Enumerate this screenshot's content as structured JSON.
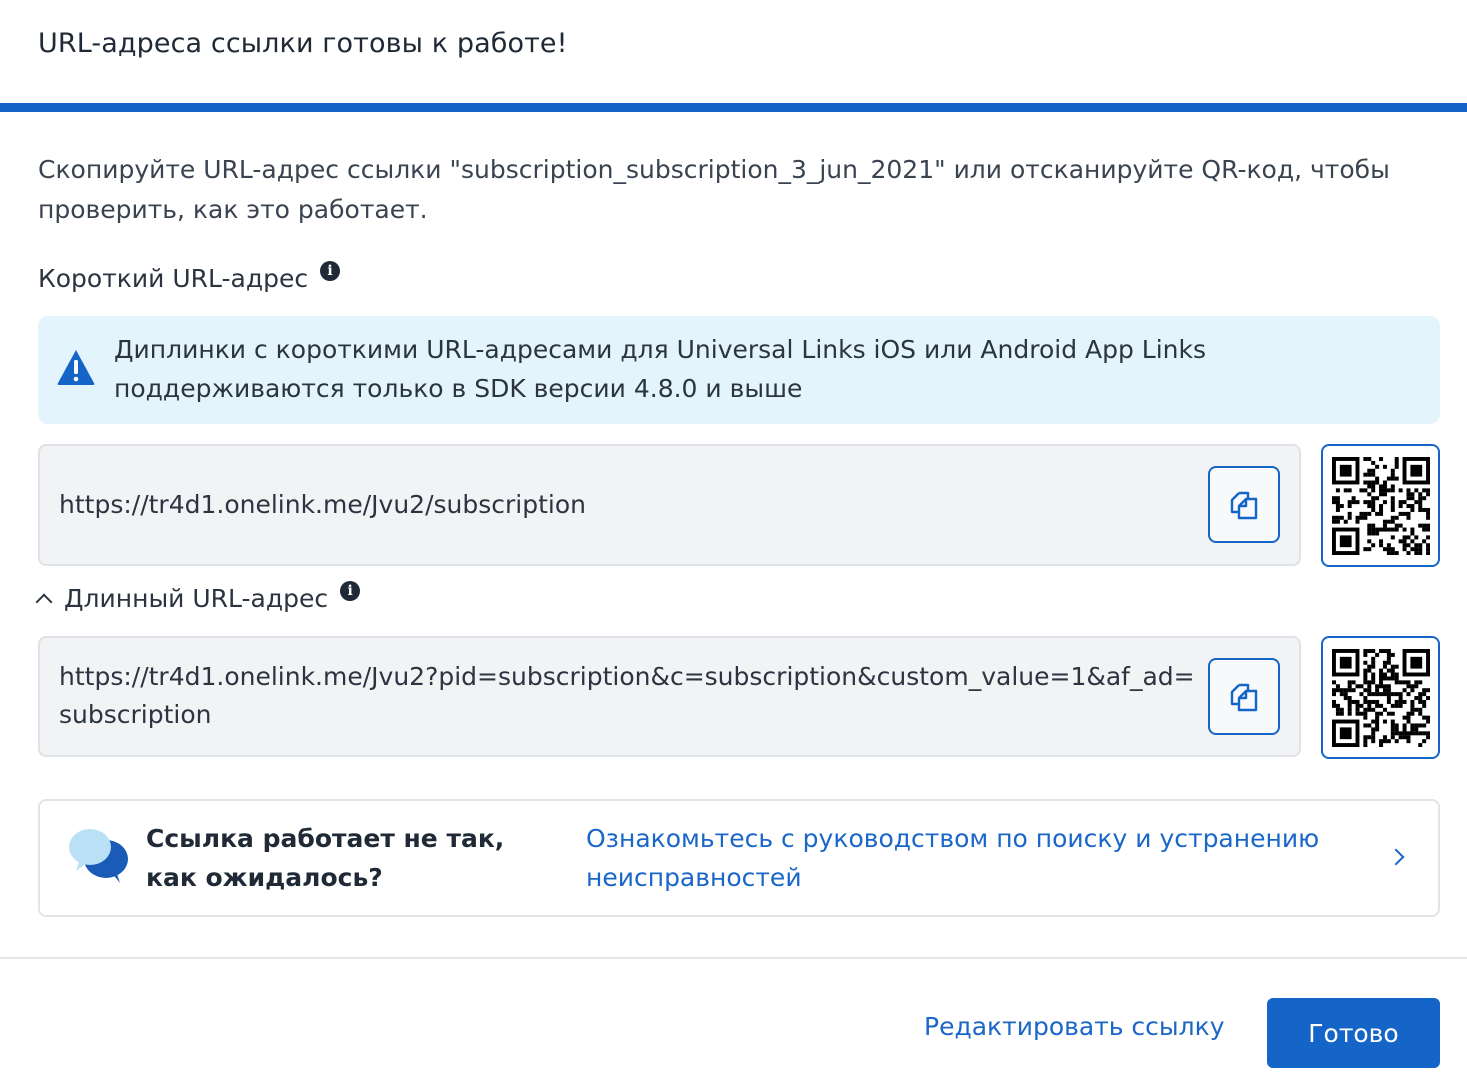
{
  "header": {
    "title": "URL-адреса ссылки готовы к работе!"
  },
  "description": "Скопируйте URL-адрес ссылки \"subscription_subscription_3_jun_2021\" или отсканируйте QR-код, чтобы проверить, как это работает.",
  "short_url": {
    "label": "Короткий URL-адрес",
    "info_icon": "i",
    "alert_text": "Диплинки с короткими URL-адресами для Universal Links iOS или Android App Links поддерживаются только в SDK версии 4.8.0 и выше",
    "value": "https://tr4d1.onelink.me/Jvu2/subscription"
  },
  "long_url": {
    "label": "Длинный URL-адрес",
    "info_icon": "i",
    "expanded": true,
    "value": "https://tr4d1.onelink.me/Jvu2?pid=subscription&c=subscription&custom_value=1&af_ad=subscription"
  },
  "help": {
    "question": "Ссылка работает не так, как ожидалось?",
    "link": "Ознакомьтесь с руководством по поиску и устранению неисправностей"
  },
  "footer": {
    "edit_label": "Редактировать ссылку",
    "done_label": "Готово"
  },
  "colors": {
    "accent": "#1565c8",
    "alert_bg": "#e4f4fc",
    "link": "#1a66c9"
  },
  "icons": [
    "info-icon",
    "warning-icon",
    "copy-icon",
    "qr-code-icon",
    "chevron-up-icon",
    "chat-bubbles-icon",
    "chevron-right-icon"
  ]
}
